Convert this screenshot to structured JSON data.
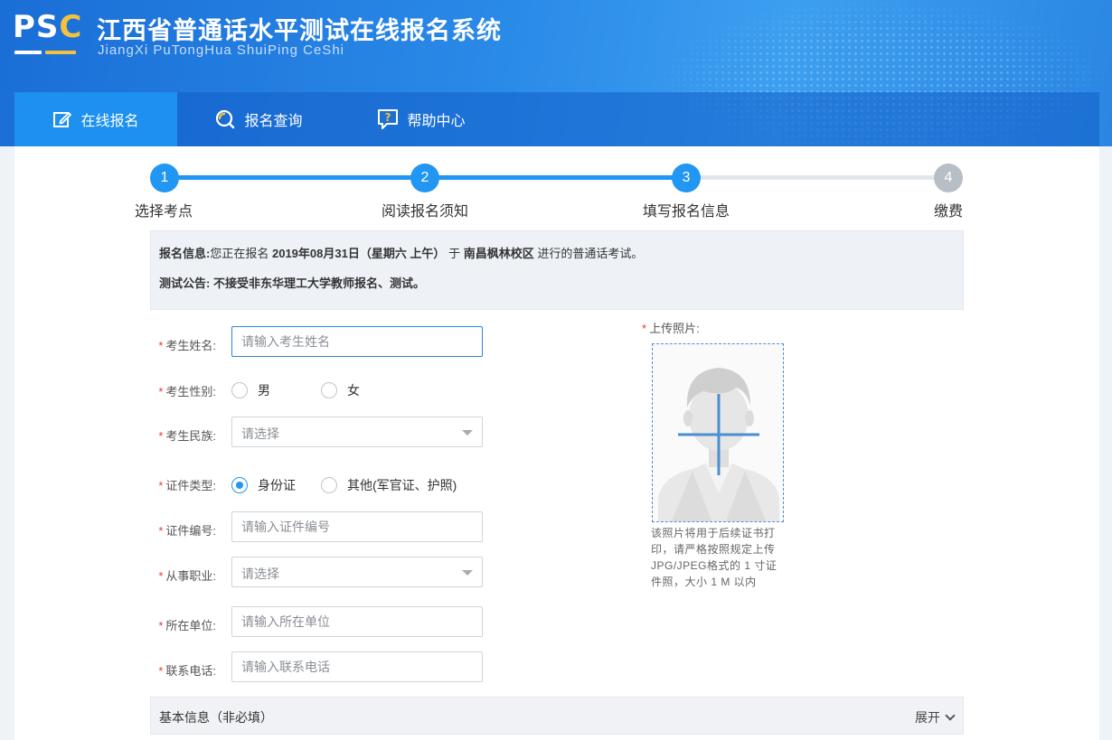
{
  "header": {
    "logo_text_left": "PS",
    "logo_text_accent": "C",
    "title_cn": "江西省普通话水平测试在线报名系统",
    "title_en": "JiangXi PuTongHua ShuiPing CeShi"
  },
  "nav": {
    "items": [
      {
        "label": "在线报名",
        "icon": "edit-icon",
        "active": true
      },
      {
        "label": "报名查询",
        "icon": "search-icon",
        "active": false
      },
      {
        "label": "帮助中心",
        "icon": "help-icon",
        "active": false
      }
    ]
  },
  "steps": [
    {
      "num": "1",
      "label": "选择考点",
      "status": "done"
    },
    {
      "num": "2",
      "label": "阅读报名须知",
      "status": "done"
    },
    {
      "num": "3",
      "label": "填写报名信息",
      "status": "current"
    },
    {
      "num": "4",
      "label": "缴费",
      "status": "todo"
    }
  ],
  "info": {
    "line1_label": "报名信息:",
    "line1_prefix": "您正在报名",
    "line1_date": "2019年08月31日（星期六 上午）",
    "line1_mid": "于",
    "line1_place": "南昌枫林校区",
    "line1_suffix": "进行的普通话考试。",
    "line2_label": "测试公告:",
    "line2_text": "不接受非东华理工大学教师报名、测试。"
  },
  "form": {
    "required_mark": "*",
    "name": {
      "label": "考生姓名:",
      "placeholder": "请输入考生姓名"
    },
    "gender": {
      "label": "考生性别:",
      "options": [
        "男",
        "女"
      ],
      "selected": null
    },
    "ethnicity": {
      "label": "考生民族:",
      "placeholder": "请选择"
    },
    "id_type": {
      "label": "证件类型:",
      "options": [
        "身份证",
        "其他(军官证、护照)"
      ],
      "selected": "身份证"
    },
    "id_number": {
      "label": "证件编号:",
      "placeholder": "请输入证件编号"
    },
    "occupation": {
      "label": "从事职业:",
      "placeholder": "请选择"
    },
    "employer": {
      "label": "所在单位:",
      "placeholder": "请输入所在单位"
    },
    "phone": {
      "label": "联系电话:",
      "placeholder": "请输入联系电话"
    }
  },
  "photo": {
    "label": "上传照片:",
    "note": "该照片将用于后续证书打印，请严格按照规定上传JPG/JPEG格式的 1 寸证件照，大小 1 M 以内"
  },
  "optional_section": {
    "title": "基本信息（非必填）",
    "expand_label": "展开"
  },
  "colors": {
    "primary": "#2196f3",
    "header_blue": "#1a6ed6",
    "required_red": "#e53935"
  }
}
